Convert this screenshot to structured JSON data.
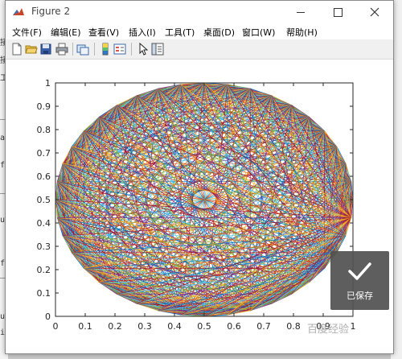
{
  "window": {
    "title": "Figure 2"
  },
  "menu": [
    "文件(F)",
    "编辑(E)",
    "查看(V)",
    "插入(I)",
    "工具(T)",
    "桌面(D)",
    "窗口(W)",
    "帮助(H)"
  ],
  "toolbar": {
    "tools": [
      {
        "name": "new-figure-icon"
      },
      {
        "name": "open-file-icon"
      },
      {
        "name": "save-icon"
      },
      {
        "name": "print-icon"
      },
      {
        "name": "link-plot-icon"
      },
      {
        "name": "colorbar-icon"
      },
      {
        "name": "legend-icon"
      },
      {
        "name": "pointer-icon"
      },
      {
        "name": "property-editor-icon"
      }
    ]
  },
  "chart_data": {
    "type": "line",
    "description_series": "many line segments connecting points on an ellipse",
    "xlim": [
      0,
      1
    ],
    "ylim": [
      0,
      1
    ],
    "xticks": [
      "0",
      "0.1",
      "0.2",
      "0.3",
      "0.4",
      "0.5",
      "0.6",
      "0.7",
      "0.8",
      "0.9",
      "1"
    ],
    "yticks": [
      "0",
      "0.1",
      "0.2",
      "0.3",
      "0.4",
      "0.5",
      "0.6",
      "0.7",
      "0.8",
      "0.9",
      "1"
    ],
    "grid": false,
    "curve": {
      "center_x": 0.5,
      "center_y": 0.5,
      "radius_x": 0.5,
      "radius_y": 0.5,
      "points": 40
    },
    "colors": [
      "#0072BD",
      "#D95319",
      "#EDB120",
      "#7E2F8E",
      "#77AC30",
      "#4DBEEE",
      "#A2142F"
    ]
  },
  "toast": {
    "label": "已保存"
  },
  "watermark": {
    "text": "百度经验"
  },
  "background": {
    "left_chars": [
      "接",
      "接",
      "工",
      "a",
      "f",
      "u",
      "f",
      "u",
      "i"
    ]
  }
}
